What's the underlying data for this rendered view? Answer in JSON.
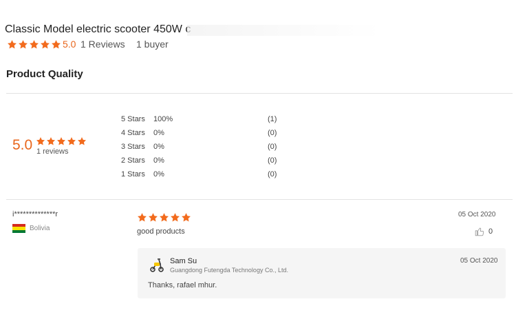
{
  "product": {
    "title": "Classic Model electric scooter 450W c",
    "rating": "5.0",
    "reviews_label": "1 Reviews",
    "buyers_label": "1 buyer",
    "stars": 5
  },
  "quality": {
    "section_title": "Product Quality",
    "score": "5.0",
    "reviews_label": "1 reviews",
    "distribution": [
      {
        "label": "5 Stars",
        "percent": "100%",
        "count": "(1)"
      },
      {
        "label": "4 Stars",
        "percent": "0%",
        "count": "(0)"
      },
      {
        "label": "3 Stars",
        "percent": "0%",
        "count": "(0)"
      },
      {
        "label": "2 Stars",
        "percent": "0%",
        "count": "(0)"
      },
      {
        "label": "1 Stars",
        "percent": "0%",
        "count": "(0)"
      }
    ]
  },
  "review": {
    "reviewer": "i**************r",
    "country": "Bolivia",
    "flag_icon": "bolivia-flag-icon",
    "stars": 5,
    "date": "05 Oct 2020",
    "text": "good products",
    "likes": "0",
    "reply": {
      "name": "Sam Su",
      "company": "Guangdong Futengda Technology Co., Ltd.",
      "date": "05 Oct 2020",
      "text": "Thanks, rafael mhur."
    }
  },
  "colors": {
    "accent": "#e8661c",
    "star": "#f26b1d",
    "divider": "#e3e3e3",
    "reply_bg": "#f5f5f5",
    "flag": [
      "#d52b1e",
      "#f9e300",
      "#007934"
    ]
  }
}
